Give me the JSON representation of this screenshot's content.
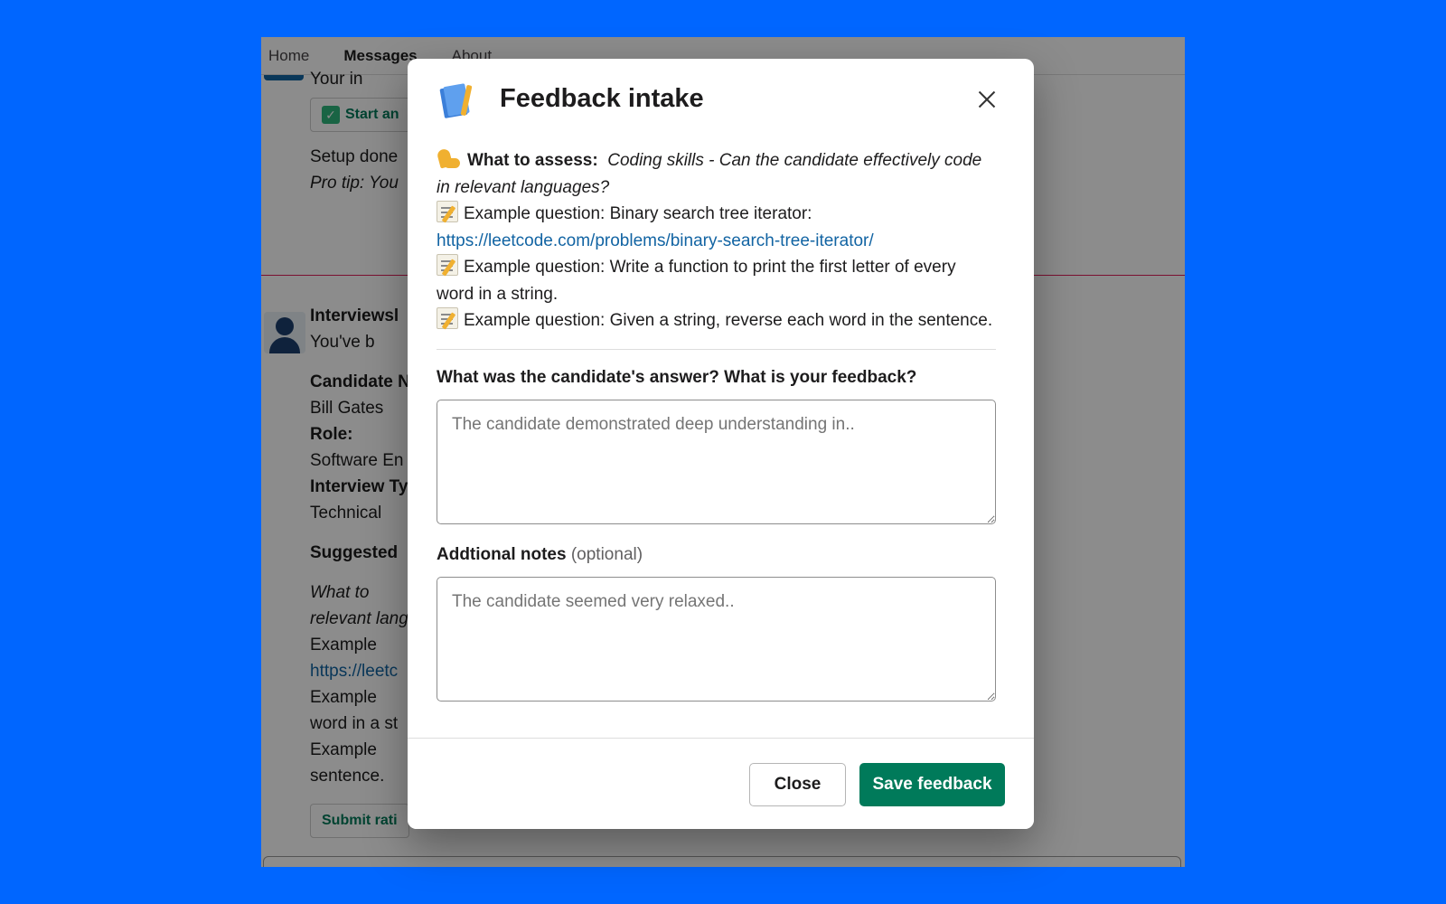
{
  "background": {
    "tabs": [
      "Home",
      "Messages",
      "About"
    ],
    "active_tab": "Messages",
    "msg1_line1": "Your in",
    "start_button": "Start an",
    "setup_text": "Setup done",
    "pro_tip": "Pro tip: You",
    "sender": "Interviewsl",
    "youve": "You've b",
    "candidate_label": "Candidate N",
    "candidate_value": "Bill Gates",
    "role_label": "Role:",
    "role_value": "Software En",
    "interview_label": "Interview Ty",
    "interview_value": "Technical",
    "suggested": "Suggested",
    "what_to": "What to",
    "relevant": "relevant lang",
    "example1": "Example",
    "link_partial": "https://leetc",
    "example2": "Example",
    "word_in": "word in a st",
    "example3": "Example",
    "sentence": "sentence.",
    "submit": "Submit rati"
  },
  "modal": {
    "title": "Feedback intake",
    "assess_label": "What to assess:",
    "assess_value": "Coding skills - Can the candidate effectively code in relevant languages?",
    "q1_prefix": "Example question: Binary search tree iterator:",
    "q1_link": "https://leetcode.com/problems/binary-search-tree-iterator/",
    "q2": "Example question: Write a function to print the first letter of every word in a string.",
    "q3": "Example question: Given a string, reverse each word in the sentence.",
    "feedback_label": "What was the candidate's answer? What is your feedback?",
    "feedback_placeholder": "The candidate demonstrated deep understanding in..",
    "notes_label": "Addtional notes",
    "notes_optional": "(optional)",
    "notes_placeholder": "The candidate seemed very relaxed..",
    "close_button": "Close",
    "save_button": "Save feedback"
  }
}
